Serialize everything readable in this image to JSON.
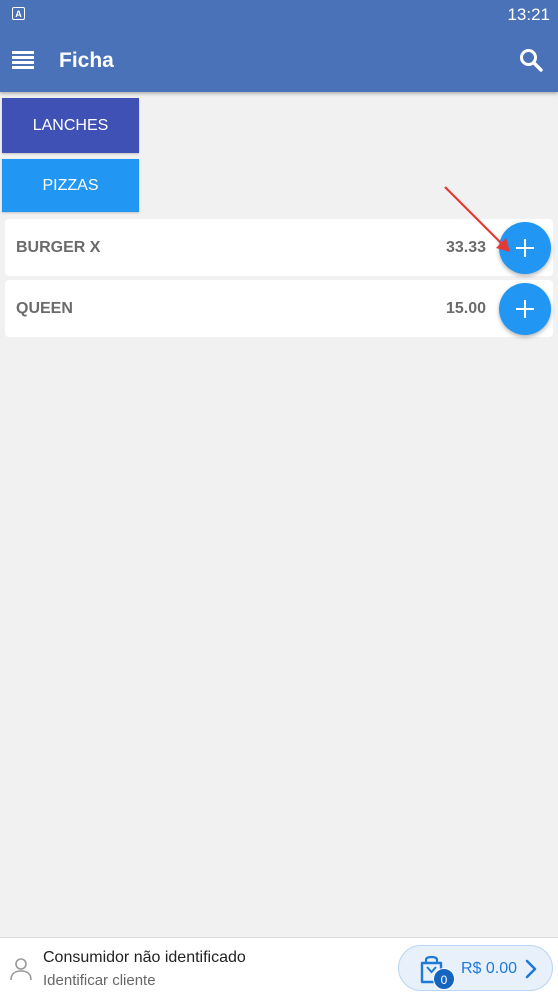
{
  "status_bar": {
    "badge": "A",
    "time": "13:21"
  },
  "app_bar": {
    "title": "Ficha",
    "menu_icon": "menu-icon",
    "search_icon": "search-icon"
  },
  "categories": [
    {
      "label": "LANCHES",
      "color": "#3f51b5"
    },
    {
      "label": "PIZZAS",
      "color": "#2196f3"
    }
  ],
  "products": [
    {
      "name": "BURGER X",
      "price": "33.33"
    },
    {
      "name": "QUEEN",
      "price": "15.00"
    }
  ],
  "footer": {
    "customer_name": "Consumidor não identificado",
    "customer_action": "Identificar cliente",
    "cart_count": "0",
    "cart_total": "R$ 0.00"
  },
  "colors": {
    "primary": "#4a72b8",
    "accent": "#2196f3",
    "annotation": "#e53935"
  }
}
